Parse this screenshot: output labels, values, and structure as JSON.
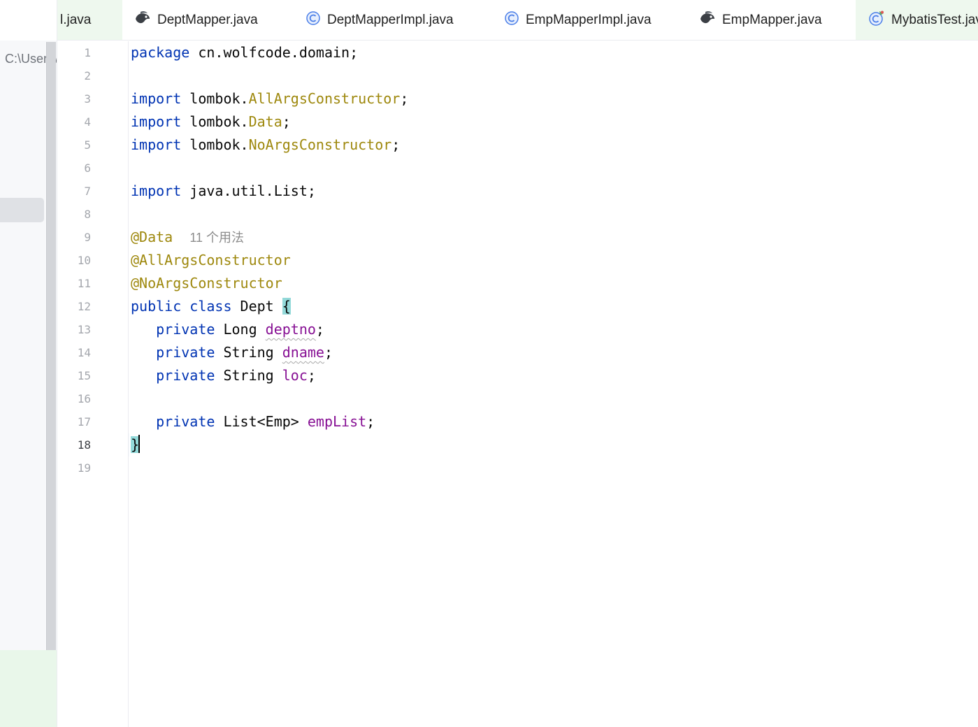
{
  "project_panel": {
    "path_text": "C:\\Users\\"
  },
  "tabs": [
    {
      "label": "l.java",
      "icon": "java-file-icon",
      "active": false
    },
    {
      "label": "DeptMapper.java",
      "icon": "mybatis-mapper-icon",
      "active": false
    },
    {
      "label": "DeptMapperImpl.java",
      "icon": "class-icon",
      "active": false
    },
    {
      "label": "EmpMapperImpl.java",
      "icon": "class-icon",
      "active": false
    },
    {
      "label": "EmpMapper.java",
      "icon": "mybatis-mapper-icon",
      "active": false
    },
    {
      "label": "MybatisTest.java",
      "icon": "test-class-icon",
      "active": false
    }
  ],
  "editor": {
    "current_line": 18,
    "line_numbers": [
      "1",
      "2",
      "3",
      "4",
      "5",
      "6",
      "7",
      "8",
      "9",
      "10",
      "11",
      "12",
      "13",
      "14",
      "15",
      "16",
      "17",
      "18",
      "19"
    ],
    "lines": [
      [
        {
          "t": "package",
          "c": "kw"
        },
        {
          "t": " cn.wolfcode.domain;",
          "c": "plain"
        }
      ],
      [],
      [
        {
          "t": "import",
          "c": "kw"
        },
        {
          "t": " lombok.",
          "c": "plain"
        },
        {
          "t": "AllArgsConstructor",
          "c": "ann"
        },
        {
          "t": ";",
          "c": "plain"
        }
      ],
      [
        {
          "t": "import",
          "c": "kw"
        },
        {
          "t": " lombok.",
          "c": "plain"
        },
        {
          "t": "Data",
          "c": "ann"
        },
        {
          "t": ";",
          "c": "plain"
        }
      ],
      [
        {
          "t": "import",
          "c": "kw"
        },
        {
          "t": " lombok.",
          "c": "plain"
        },
        {
          "t": "NoArgsConstructor",
          "c": "ann"
        },
        {
          "t": ";",
          "c": "plain"
        }
      ],
      [],
      [
        {
          "t": "import",
          "c": "kw"
        },
        {
          "t": " java.util.List;",
          "c": "plain"
        }
      ],
      [],
      [
        {
          "t": "@Data",
          "c": "ann"
        },
        {
          "t": "  ",
          "c": "plain"
        },
        {
          "t": "11 个用法",
          "c": "hint"
        }
      ],
      [
        {
          "t": "@AllArgsConstructor",
          "c": "ann"
        }
      ],
      [
        {
          "t": "@NoArgsConstructor",
          "c": "ann"
        }
      ],
      [
        {
          "t": "public",
          "c": "kw"
        },
        {
          "t": " ",
          "c": "plain"
        },
        {
          "t": "class",
          "c": "kw"
        },
        {
          "t": " Dept ",
          "c": "plain"
        },
        {
          "t": "{",
          "c": "plain brace-hl"
        }
      ],
      [
        {
          "t": "   ",
          "c": "plain"
        },
        {
          "t": "private",
          "c": "kw"
        },
        {
          "t": " Long ",
          "c": "plain"
        },
        {
          "t": "deptno",
          "c": "fld squiggle"
        },
        {
          "t": ";",
          "c": "plain"
        }
      ],
      [
        {
          "t": "   ",
          "c": "plain"
        },
        {
          "t": "private",
          "c": "kw"
        },
        {
          "t": " String ",
          "c": "plain"
        },
        {
          "t": "dname",
          "c": "fld squiggle"
        },
        {
          "t": ";",
          "c": "plain"
        }
      ],
      [
        {
          "t": "   ",
          "c": "plain"
        },
        {
          "t": "private",
          "c": "kw"
        },
        {
          "t": " String ",
          "c": "plain"
        },
        {
          "t": "loc",
          "c": "fld"
        },
        {
          "t": ";",
          "c": "plain"
        }
      ],
      [],
      [
        {
          "t": "   ",
          "c": "plain"
        },
        {
          "t": "private",
          "c": "kw"
        },
        {
          "t": " List<Emp> ",
          "c": "plain"
        },
        {
          "t": "empList",
          "c": "fld"
        },
        {
          "t": ";",
          "c": "plain"
        }
      ],
      [
        {
          "t": "}",
          "c": "plain brace-hl"
        },
        {
          "t": "",
          "c": "caret"
        }
      ],
      []
    ]
  }
}
